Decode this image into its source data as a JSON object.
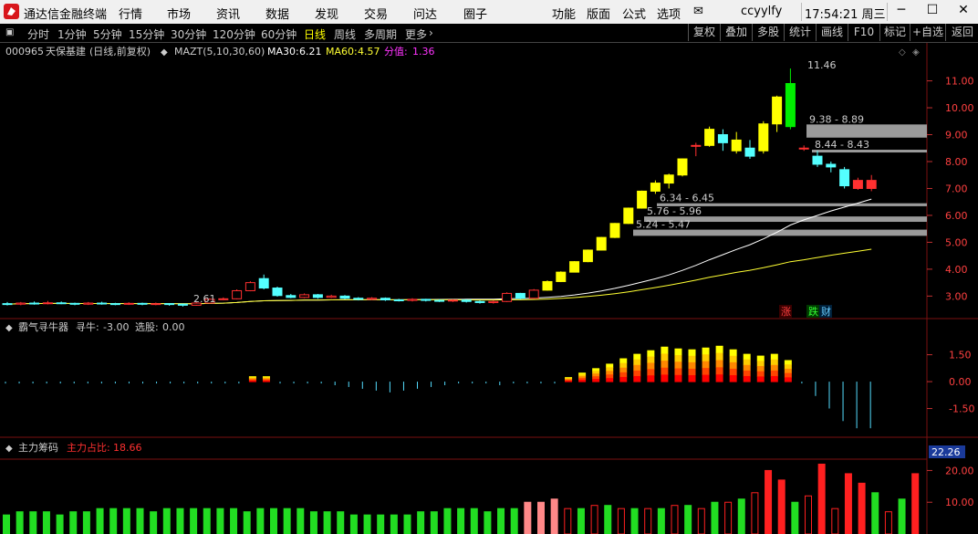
{
  "app": {
    "title": "通达信金融终端",
    "menu": [
      "行情",
      "市场",
      "资讯",
      "数据",
      "发现",
      "交易",
      "问达",
      "圈子"
    ],
    "right_menu": [
      "功能",
      "版面",
      "公式",
      "选项"
    ],
    "username": "ccyylfy",
    "clock": "17:54:21 周三",
    "minimize": "─",
    "maximize": "☐",
    "close": "✕"
  },
  "toolbar": {
    "periods": [
      "分时",
      "1分钟",
      "5分钟",
      "15分钟",
      "30分钟",
      "120分钟",
      "60分钟",
      "日线",
      "周线",
      "多周期",
      "更多"
    ],
    "active_period": "日线",
    "right_tools": [
      "复权",
      "叠加",
      "多股",
      "统计",
      "画线",
      "F10",
      "标记",
      "+自选",
      "返回"
    ]
  },
  "main_chart": {
    "stock_code": "000965",
    "stock_name": "天保基建",
    "period_info": "(日线,前复权)",
    "indicator_name": "MAZT(5,10,30,60)",
    "ma30_label": "MA30:",
    "ma30_value": "6.21",
    "ma60_label": "MA60:",
    "ma60_value": "4.57",
    "fenzhi_label": "分值:",
    "fenzhi_value": "1.36",
    "high_label": "11.46",
    "low_label": "2.61",
    "zones": [
      "9.38 - 8.89",
      "8.44 - 8.43",
      "6.34 - 6.45",
      "5.76 - 5.96",
      "5.24 - 5.47"
    ],
    "markers": [
      "涨",
      "跌",
      "财"
    ],
    "colors": {
      "up": "#ff3030",
      "down": "#54ffff",
      "yellow": "#ffff00",
      "green": "#00ee00",
      "ma30": "#ffffff",
      "ma60": "#ffff33"
    }
  },
  "sub1": {
    "name": "霸气寻牛器",
    "xun_niu_label": "寻牛:",
    "xun_niu_value": "-3.00",
    "xuan_gu_label": "选股:",
    "xuan_gu_value": "0.00"
  },
  "sub2": {
    "name": "主力筹码",
    "zhuli_label": "主力占比:",
    "zhuli_value": "18.66",
    "current_value": "22.26"
  },
  "chart_data": {
    "type": "candlestick",
    "y_axis_main": {
      "ticks": [
        "11.00",
        "10.00",
        "9.00",
        "8.00",
        "7.00",
        "6.00",
        "5.00",
        "4.00",
        "3.00"
      ],
      "range": [
        2.3,
        11.8
      ]
    },
    "candles": [
      {
        "o": 2.72,
        "c": 2.7,
        "h": 2.78,
        "l": 2.65
      },
      {
        "o": 2.7,
        "c": 2.74,
        "h": 2.78,
        "l": 2.66
      },
      {
        "o": 2.74,
        "c": 2.72,
        "h": 2.8,
        "l": 2.68
      },
      {
        "o": 2.72,
        "c": 2.75,
        "h": 2.82,
        "l": 2.69
      },
      {
        "o": 2.75,
        "c": 2.73,
        "h": 2.8,
        "l": 2.7
      },
      {
        "o": 2.73,
        "c": 2.7,
        "h": 2.76,
        "l": 2.66
      },
      {
        "o": 2.7,
        "c": 2.74,
        "h": 2.78,
        "l": 2.67
      },
      {
        "o": 2.74,
        "c": 2.72,
        "h": 2.79,
        "l": 2.68
      },
      {
        "o": 2.72,
        "c": 2.7,
        "h": 2.75,
        "l": 2.66
      },
      {
        "o": 2.7,
        "c": 2.73,
        "h": 2.77,
        "l": 2.67
      },
      {
        "o": 2.73,
        "c": 2.7,
        "h": 2.76,
        "l": 2.66
      },
      {
        "o": 2.7,
        "c": 2.72,
        "h": 2.76,
        "l": 2.66
      },
      {
        "o": 2.72,
        "c": 2.7,
        "h": 2.74,
        "l": 2.64
      },
      {
        "o": 2.7,
        "c": 2.66,
        "h": 2.72,
        "l": 2.61
      },
      {
        "o": 2.66,
        "c": 2.74,
        "h": 2.78,
        "l": 2.64
      },
      {
        "o": 2.74,
        "c": 2.88,
        "h": 2.92,
        "l": 2.72
      },
      {
        "o": 2.88,
        "c": 2.9,
        "h": 2.95,
        "l": 2.85
      },
      {
        "o": 2.9,
        "c": 3.2,
        "h": 3.25,
        "l": 2.88
      },
      {
        "o": 3.2,
        "c": 3.5,
        "h": 3.55,
        "l": 3.18
      },
      {
        "o": 3.65,
        "c": 3.3,
        "h": 3.8,
        "l": 3.25
      },
      {
        "o": 3.3,
        "c": 3.02,
        "h": 3.35,
        "l": 2.98
      },
      {
        "o": 3.02,
        "c": 2.95,
        "h": 3.08,
        "l": 2.92
      },
      {
        "o": 2.95,
        "c": 3.05,
        "h": 3.1,
        "l": 2.92
      },
      {
        "o": 3.05,
        "c": 2.95,
        "h": 3.08,
        "l": 2.9
      },
      {
        "o": 2.95,
        "c": 3.0,
        "h": 3.05,
        "l": 2.92
      },
      {
        "o": 3.0,
        "c": 2.92,
        "h": 3.04,
        "l": 2.88
      },
      {
        "o": 2.92,
        "c": 2.88,
        "h": 2.96,
        "l": 2.84
      },
      {
        "o": 2.88,
        "c": 2.92,
        "h": 2.96,
        "l": 2.85
      },
      {
        "o": 2.92,
        "c": 2.86,
        "h": 2.95,
        "l": 2.82
      },
      {
        "o": 2.86,
        "c": 2.84,
        "h": 2.9,
        "l": 2.8
      },
      {
        "o": 2.84,
        "c": 2.88,
        "h": 2.92,
        "l": 2.8
      },
      {
        "o": 2.88,
        "c": 2.84,
        "h": 2.9,
        "l": 2.8
      },
      {
        "o": 2.84,
        "c": 2.82,
        "h": 2.88,
        "l": 2.78
      },
      {
        "o": 2.82,
        "c": 2.85,
        "h": 2.88,
        "l": 2.78
      },
      {
        "o": 2.85,
        "c": 2.8,
        "h": 2.88,
        "l": 2.76
      },
      {
        "o": 2.8,
        "c": 2.76,
        "h": 2.84,
        "l": 2.72
      },
      {
        "o": 2.76,
        "c": 2.8,
        "h": 2.84,
        "l": 2.72
      },
      {
        "o": 2.8,
        "c": 3.1,
        "h": 3.14,
        "l": 2.78
      },
      {
        "o": 3.1,
        "c": 2.92,
        "h": 3.12,
        "l": 2.88
      },
      {
        "o": 2.92,
        "c": 3.22,
        "h": 3.26,
        "l": 2.9
      },
      {
        "o": 3.22,
        "c": 3.54,
        "h": 3.58,
        "l": 3.2
      },
      {
        "o": 3.54,
        "c": 3.89,
        "h": 3.92,
        "l": 3.52
      },
      {
        "o": 3.89,
        "c": 4.28,
        "h": 4.3,
        "l": 3.88
      },
      {
        "o": 4.28,
        "c": 4.71,
        "h": 4.73,
        "l": 4.26
      },
      {
        "o": 4.71,
        "c": 5.18,
        "h": 5.2,
        "l": 4.7
      },
      {
        "o": 5.18,
        "c": 5.7,
        "h": 5.72,
        "l": 5.16
      },
      {
        "o": 5.7,
        "c": 6.27,
        "h": 6.29,
        "l": 5.68
      },
      {
        "o": 6.27,
        "c": 6.9,
        "h": 6.92,
        "l": 6.25
      },
      {
        "o": 6.9,
        "c": 7.2,
        "h": 7.3,
        "l": 6.8
      },
      {
        "o": 7.2,
        "c": 7.5,
        "h": 7.55,
        "l": 7.0
      },
      {
        "o": 7.5,
        "c": 8.1,
        "h": 8.12,
        "l": 7.45
      },
      {
        "o": 8.6,
        "c": 8.6,
        "h": 8.7,
        "l": 8.2
      },
      {
        "o": 8.6,
        "c": 9.2,
        "h": 9.3,
        "l": 8.55
      },
      {
        "o": 9.0,
        "c": 8.7,
        "h": 9.2,
        "l": 8.4
      },
      {
        "o": 8.4,
        "c": 8.8,
        "h": 9.1,
        "l": 8.3
      },
      {
        "o": 8.5,
        "c": 8.2,
        "h": 8.8,
        "l": 8.1
      },
      {
        "o": 8.4,
        "c": 9.4,
        "h": 9.5,
        "l": 8.3
      },
      {
        "o": 9.4,
        "c": 10.4,
        "h": 10.45,
        "l": 9.1
      },
      {
        "o": 9.3,
        "c": 10.9,
        "h": 11.46,
        "l": 9.2
      },
      {
        "o": 8.5,
        "c": 8.5,
        "h": 8.6,
        "l": 8.4
      },
      {
        "o": 8.2,
        "c": 7.9,
        "h": 8.4,
        "l": 7.8
      },
      {
        "o": 7.9,
        "c": 7.8,
        "h": 8.0,
        "l": 7.6
      },
      {
        "o": 7.7,
        "c": 7.1,
        "h": 7.8,
        "l": 7.0
      },
      {
        "o": 7.0,
        "c": 7.3,
        "h": 7.4,
        "l": 6.95
      },
      {
        "o": 7.0,
        "c": 7.3,
        "h": 7.5,
        "l": 6.9
      }
    ],
    "sub1_bars": [
      0,
      0,
      0,
      0,
      0,
      0,
      0,
      0,
      0,
      0,
      0,
      0,
      0,
      0,
      0,
      0,
      0,
      0,
      0.3,
      0.3,
      0,
      0,
      0,
      0,
      -0.2,
      -0.3,
      -0.4,
      -0.5,
      -0.6,
      -0.5,
      -0.4,
      -0.3,
      -0.2,
      -0.1,
      -0.1,
      -0.1,
      -0.2,
      -0.1,
      -0.1,
      0,
      0,
      0.25,
      0.5,
      0.75,
      1.0,
      1.3,
      1.55,
      1.75,
      1.95,
      1.85,
      1.8,
      1.9,
      2.0,
      1.8,
      1.55,
      1.45,
      1.55,
      1.2,
      0,
      -0.8,
      -1.5,
      -2.2,
      -2.6,
      -2.6
    ],
    "sub1_y_ticks": [
      "1.50",
      "0.00",
      "-1.50"
    ],
    "sub2_bars": [
      6,
      7,
      7,
      7,
      6,
      7,
      7,
      8,
      8,
      8,
      8,
      7,
      8,
      8,
      8,
      8,
      8,
      8,
      7,
      8,
      8,
      8,
      8,
      7,
      7,
      7,
      6,
      6,
      6,
      6,
      6,
      7,
      7,
      8,
      8,
      8,
      7,
      8,
      8,
      10,
      10,
      11,
      8,
      8,
      9,
      9,
      8,
      8,
      8,
      8,
      9,
      9,
      8,
      10,
      10,
      11,
      13,
      20,
      17,
      10,
      12,
      22,
      8,
      19,
      16,
      13,
      7,
      11,
      19
    ],
    "sub2_y_ticks": [
      "20.00",
      "10.00"
    ]
  }
}
